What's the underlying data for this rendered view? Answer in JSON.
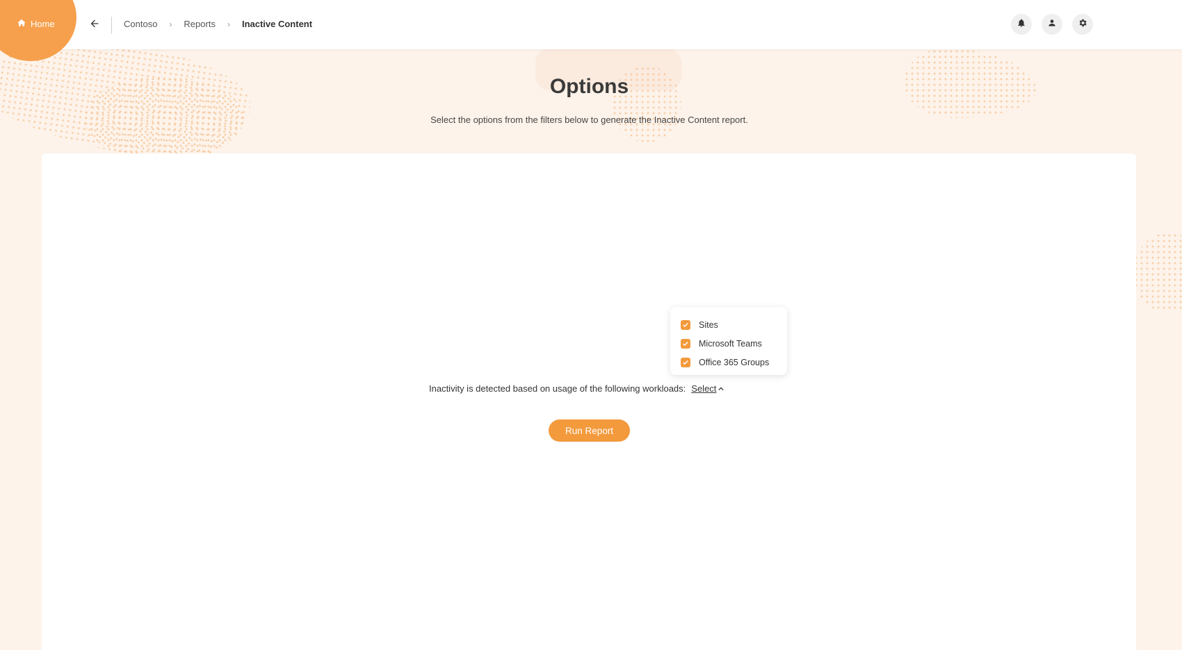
{
  "nav": {
    "home_label": "Home",
    "breadcrumbs": [
      {
        "label": "Contoso"
      },
      {
        "label": "Reports"
      },
      {
        "label": "Inactive Content"
      }
    ]
  },
  "header": {
    "title": "Options",
    "subtitle": "Select the options from the filters below to generate the Inactive Content report."
  },
  "filters": {
    "workloads_label": "Inactivity is detected based on usage of the following workloads:",
    "select_label": "Select",
    "options": [
      {
        "label": "Sites",
        "checked": true
      },
      {
        "label": "Microsoft Teams",
        "checked": true
      },
      {
        "label": "Office 365 Groups",
        "checked": true
      }
    ]
  },
  "actions": {
    "run_report_label": "Run Report"
  },
  "colors": {
    "accent": "#f39a3c",
    "home_circle": "#f6a04d",
    "background": "#fdf3ea"
  },
  "icons": {
    "home": "home-icon",
    "back": "arrow-left-icon",
    "notifications": "bell-icon",
    "user": "user-icon",
    "settings": "gear-icon",
    "checkbox": "checkmark-icon",
    "dropdown": "chevron-up-icon"
  }
}
